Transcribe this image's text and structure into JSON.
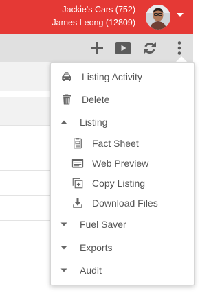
{
  "header": {
    "account_line1": "Jackie's Cars (752)",
    "account_line2": "James Leong (12809)",
    "avatar_icon": "user-avatar",
    "menu_caret_icon": "caret-down-icon",
    "bg_color": "#e53935"
  },
  "toolbar": {
    "icons": [
      "plus-icon",
      "video-icon",
      "refresh-icon",
      "more-vertical-icon"
    ],
    "bg_color": "#e0e0e0"
  },
  "menu": {
    "listing_activity": "Listing Activity",
    "delete": "Delete",
    "listing_section": "Listing",
    "fact_sheet": "Fact Sheet",
    "web_preview": "Web Preview",
    "copy_listing": "Copy Listing",
    "download_files": "Download Files",
    "fuel_saver_section": "Fuel Saver",
    "exports_section": "Exports",
    "audit_section": "Audit",
    "listing_expanded": true,
    "fuel_saver_expanded": false,
    "exports_expanded": false,
    "audit_expanded": false
  }
}
